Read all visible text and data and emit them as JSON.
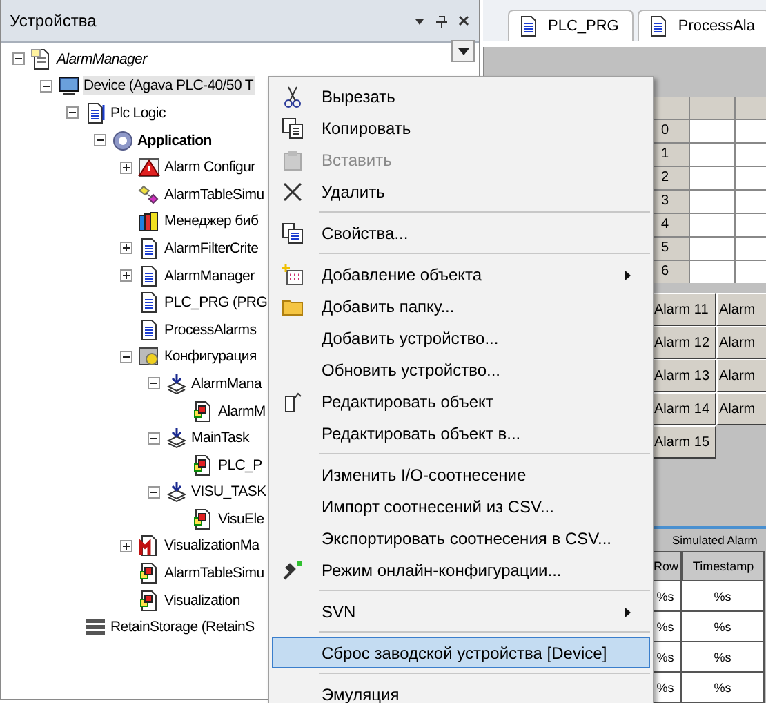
{
  "devices_panel": {
    "title": "Устройства",
    "tree": [
      {
        "label": "AlarmManager",
        "kind": "project",
        "expanded": true,
        "selected": false,
        "children": [
          {
            "label": "Device (Agava PLC-40/50 T",
            "kind": "device",
            "expanded": true,
            "selected": true,
            "children": [
              {
                "label": "Plc Logic",
                "kind": "plc-logic",
                "expanded": true,
                "selected": false,
                "children": [
                  {
                    "label": "Application",
                    "kind": "application",
                    "expanded": true,
                    "selected": false,
                    "children": [
                      {
                        "label": "Alarm Configur",
                        "kind": "alarm-config",
                        "expanded": false,
                        "selected": false
                      },
                      {
                        "label": "AlarmTableSimu",
                        "kind": "table-sim",
                        "selected": false
                      },
                      {
                        "label": "Менеджер биб",
                        "kind": "library",
                        "selected": false
                      },
                      {
                        "label": "AlarmFilterCrite",
                        "kind": "pou",
                        "expanded": false,
                        "selected": false
                      },
                      {
                        "label": "AlarmManager",
                        "kind": "pou",
                        "expanded": false,
                        "selected": false
                      },
                      {
                        "label": "PLC_PRG (PRG",
                        "kind": "pou",
                        "selected": false
                      },
                      {
                        "label": "ProcessAlarms",
                        "kind": "pou",
                        "selected": false
                      },
                      {
                        "label": "Конфигурация",
                        "kind": "task-config",
                        "expanded": true,
                        "selected": false,
                        "children": [
                          {
                            "label": "AlarmMana",
                            "kind": "task",
                            "expanded": true,
                            "selected": false,
                            "children": [
                              {
                                "label": "AlarmM",
                                "kind": "task-call",
                                "selected": false
                              }
                            ]
                          },
                          {
                            "label": "MainTask",
                            "kind": "task",
                            "expanded": true,
                            "selected": false,
                            "children": [
                              {
                                "label": "PLC_P",
                                "kind": "task-call",
                                "selected": false
                              }
                            ]
                          },
                          {
                            "label": "VISU_TASK",
                            "kind": "task",
                            "expanded": true,
                            "selected": false,
                            "children": [
                              {
                                "label": "VisuEle",
                                "kind": "task-call",
                                "selected": false
                              }
                            ]
                          }
                        ]
                      },
                      {
                        "label": "VisualizationMa",
                        "kind": "visu-manager",
                        "expanded": false,
                        "selected": false
                      },
                      {
                        "label": "AlarmTableSimu",
                        "kind": "visu",
                        "selected": false
                      },
                      {
                        "label": "Visualization",
                        "kind": "visu",
                        "selected": false
                      }
                    ]
                  }
                ]
              },
              {
                "label": "RetainStorage (RetainS",
                "kind": "retain",
                "selected": false
              }
            ]
          }
        ]
      }
    ]
  },
  "editor_tabs": [
    {
      "label": "PLC_PRG",
      "selected": false
    },
    {
      "label": "ProcessAla",
      "selected": false
    }
  ],
  "visualization": {
    "index_rows": [
      "0",
      "1",
      "2",
      "3",
      "4",
      "5",
      "6"
    ],
    "alarm_buttons": [
      "Alarm 11",
      "Alarm",
      "Alarm 12",
      "Alarm",
      "Alarm 13",
      "Alarm",
      "Alarm 14",
      "Alarm",
      "Alarm 15"
    ],
    "alarm_table": {
      "title": "Simulated Alarm",
      "columns": [
        "Row",
        "Timestamp"
      ],
      "rows": [
        [
          "%s",
          "%s"
        ],
        [
          "%s",
          "%s"
        ],
        [
          "%s",
          "%s"
        ],
        [
          "%s",
          "%s"
        ]
      ]
    }
  },
  "context_menu": [
    {
      "kind": "item",
      "label": "Вырезать",
      "disabled": false,
      "selected": false,
      "submenu": false
    },
    {
      "kind": "item",
      "label": "Копировать",
      "disabled": false,
      "selected": false,
      "submenu": false
    },
    {
      "kind": "item",
      "label": "Вставить",
      "disabled": true,
      "selected": false,
      "submenu": false
    },
    {
      "kind": "item",
      "label": "Удалить",
      "disabled": false,
      "selected": false,
      "submenu": false
    },
    {
      "kind": "separator"
    },
    {
      "kind": "item",
      "label": "Свойства...",
      "disabled": false,
      "selected": false,
      "submenu": false
    },
    {
      "kind": "separator"
    },
    {
      "kind": "item",
      "label": "Добавление объекта",
      "disabled": false,
      "selected": false,
      "submenu": true
    },
    {
      "kind": "item",
      "label": "Добавить папку...",
      "disabled": false,
      "selected": false,
      "submenu": false
    },
    {
      "kind": "item",
      "label": "Добавить устройство...",
      "disabled": false,
      "selected": false,
      "submenu": false
    },
    {
      "kind": "item",
      "label": "Обновить устройство...",
      "disabled": false,
      "selected": false,
      "submenu": false
    },
    {
      "kind": "item",
      "label": "Редактировать объект",
      "disabled": false,
      "selected": false,
      "submenu": false
    },
    {
      "kind": "item",
      "label": "Редактировать объект в...",
      "disabled": false,
      "selected": false,
      "submenu": false
    },
    {
      "kind": "separator"
    },
    {
      "kind": "item",
      "label": "Изменить I/O-соотнесение",
      "disabled": false,
      "selected": false,
      "submenu": false
    },
    {
      "kind": "item",
      "label": "Импорт соотнесений из CSV...",
      "disabled": false,
      "selected": false,
      "submenu": false
    },
    {
      "kind": "item",
      "label": "Экспортировать соотнесения в CSV...",
      "disabled": false,
      "selected": false,
      "submenu": false
    },
    {
      "kind": "item",
      "label": "Режим онлайн-конфигурации...",
      "disabled": false,
      "selected": false,
      "submenu": false
    },
    {
      "kind": "separator"
    },
    {
      "kind": "item",
      "label": "SVN",
      "disabled": false,
      "selected": false,
      "submenu": true
    },
    {
      "kind": "separator"
    },
    {
      "kind": "item",
      "label": "Сброс заводской устройства [Device]",
      "disabled": false,
      "selected": true,
      "submenu": false
    },
    {
      "kind": "separator"
    },
    {
      "kind": "item",
      "label": "Эмуляция",
      "disabled": false,
      "selected": false,
      "submenu": false
    }
  ]
}
